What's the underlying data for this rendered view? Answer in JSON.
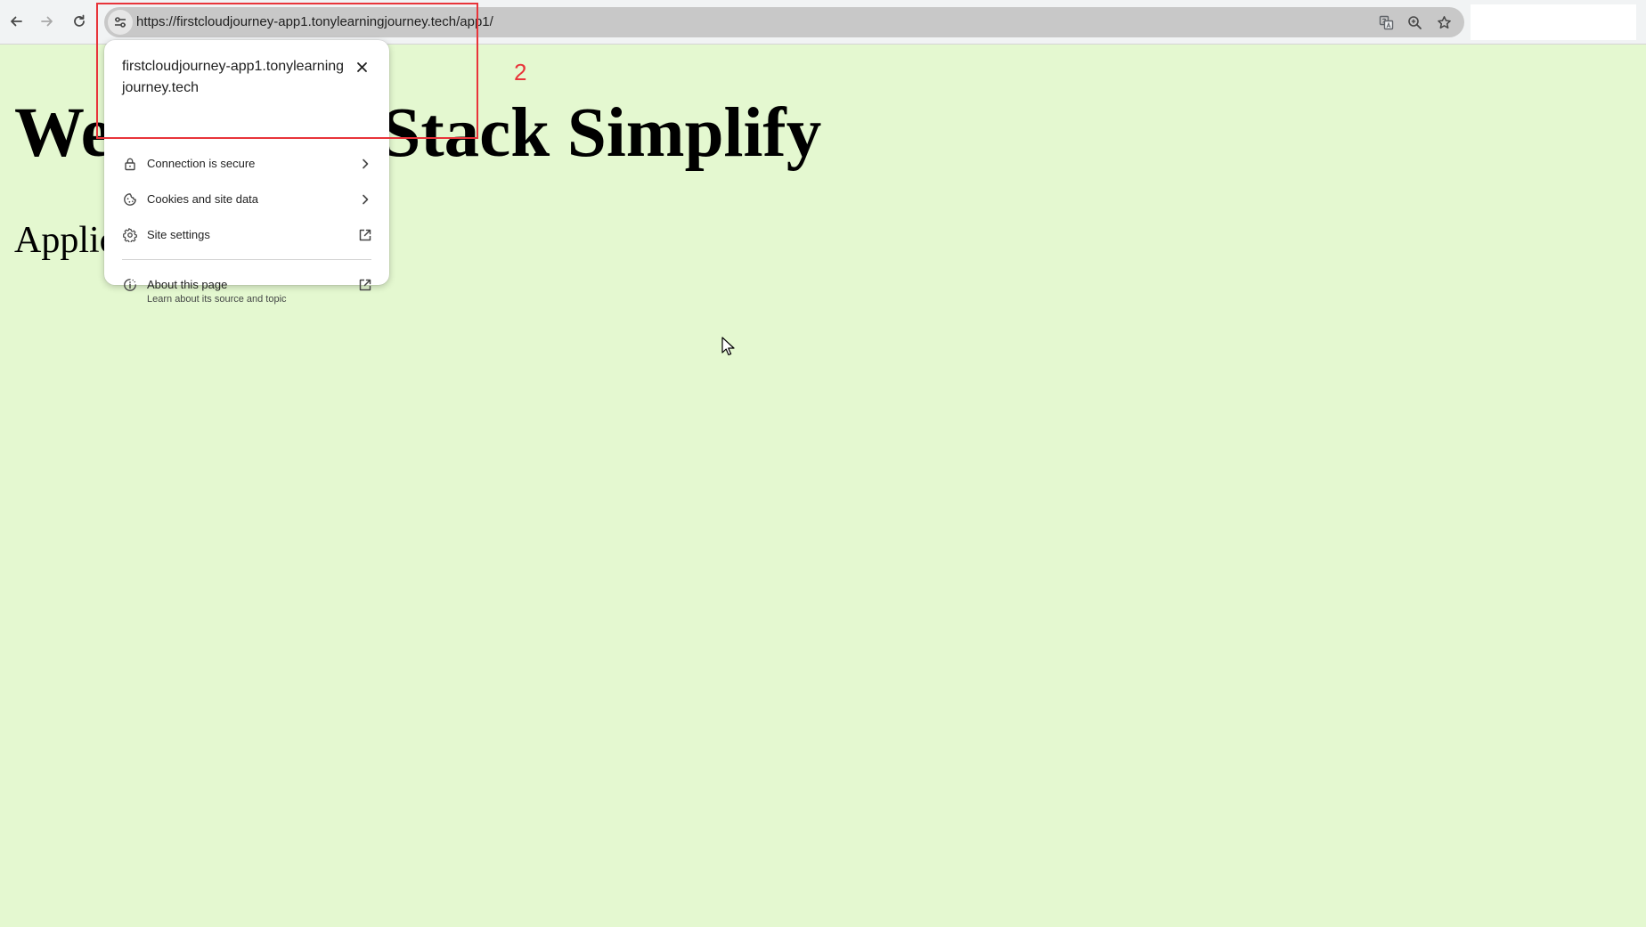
{
  "browser": {
    "url": "https://firstcloudjourney-app1.tonylearningjourney.tech/app1/"
  },
  "page": {
    "heading": "Welcome to Stack Simplify",
    "subheading": "Application Name: App1",
    "background_color": "#e4f8d0"
  },
  "site_info_popup": {
    "title": "firstcloudjourney-app1.tonylearningjourney.tech",
    "items": [
      {
        "label": "Connection is secure",
        "icon": "lock-icon",
        "trailing": "chevron-right-icon"
      },
      {
        "label": "Cookies and site data",
        "icon": "cookie-icon",
        "trailing": "chevron-right-icon"
      },
      {
        "label": "Site settings",
        "icon": "gear-icon",
        "trailing": "external-link-icon"
      },
      {
        "label": "About this page",
        "sublabel": "Learn about its source and topic",
        "icon": "page-info-icon",
        "trailing": "external-link-icon"
      }
    ]
  },
  "annotation": {
    "number": "2",
    "color": "#e8343a"
  }
}
